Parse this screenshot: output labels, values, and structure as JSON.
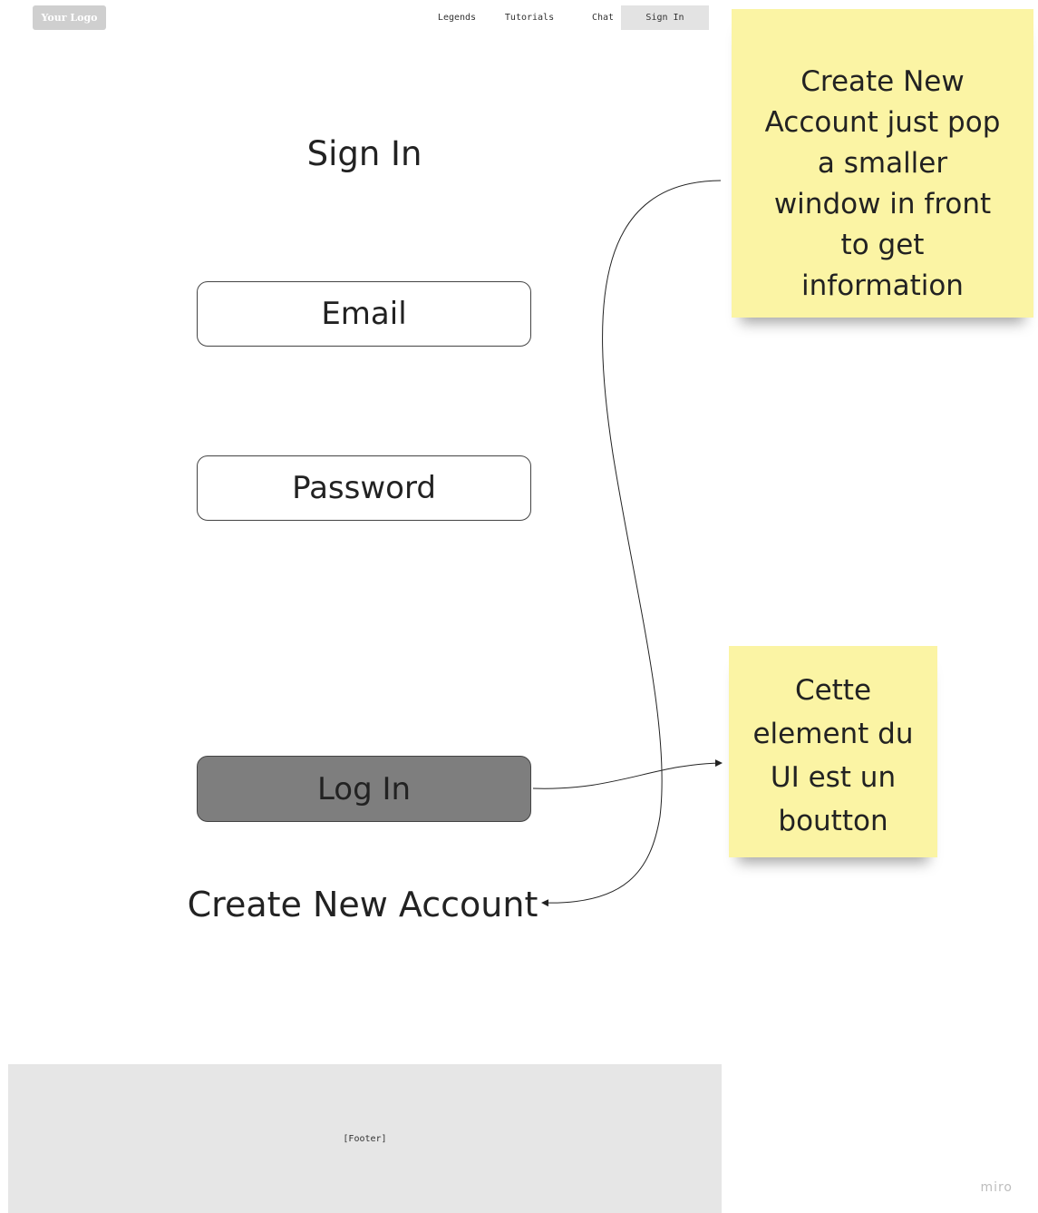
{
  "header": {
    "logo_text": "Your Logo",
    "nav": [
      "Legends",
      "Tutorials",
      "Chat",
      "Sign In"
    ]
  },
  "form": {
    "title": "Sign In",
    "email_placeholder": "Email",
    "password_placeholder": "Password",
    "login_label": "Log In",
    "create_account_label": "Create New Account"
  },
  "notes": [
    "Create New Account just pop a smaller window in front to get information",
    "Cette element du UI est un boutton"
  ],
  "footer": {
    "label": "[Footer]"
  },
  "watermark": "miro",
  "colors": {
    "sticky": "#fbf4a4",
    "login_button": "#7e7e7e",
    "footer": "#e6e6e6",
    "logo_bg": "#cfcfcf"
  }
}
